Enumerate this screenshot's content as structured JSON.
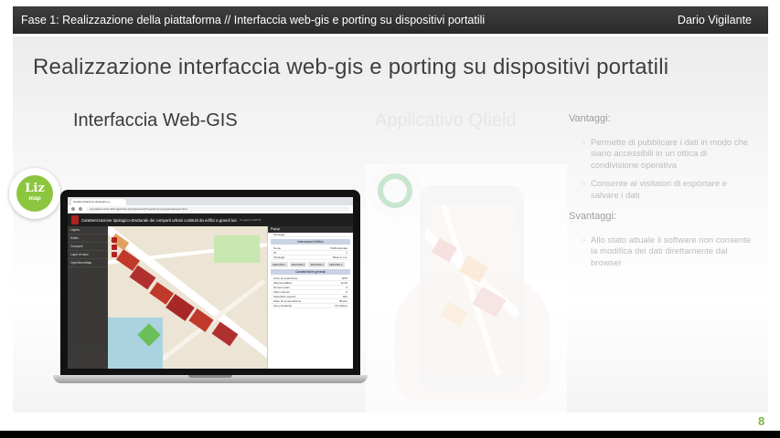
{
  "header": {
    "breadcrumb": "Fase 1: Realizzazione della piattaforma // Interfaccia web-gis e porting su dispositivi portatili",
    "author": "Dario Vigilante"
  },
  "slide": {
    "title": "Realizzazione interfaccia web-gis e porting su dispositivi portatili",
    "left_heading": "Interfaccia Web-GIS",
    "right_heading": "Applicativo Qfield",
    "page_number": "8"
  },
  "bullets": {
    "vantaggi_heading": "Vantaggi:",
    "vantaggi": [
      "Permette di pubblicare i dati in modo che siano accessibili in un ottica di condivisione operativa",
      "Consente ai visitatori di esportare e salvare i dati"
    ],
    "svantaggi_heading": "Svantaggi:",
    "svantaggi": [
      "Allo stato attuale il software non consente la modifica dei dati direttamente dal browser"
    ]
  },
  "logos": {
    "liz_text": "Liz",
    "liz_sub": "map"
  },
  "laptop_screen": {
    "tab_title": "Caratterizzazione tipologico-s...",
    "address": "sigmaterra.unict.it/lizmap/index.php/view/map/?repository=progetto&project=test",
    "app_title": "Caratterizzazione tipologico-strutturale dei comparti urbani costituiti da edifici a grandi luci",
    "app_sub": "Progetto CARTIS",
    "side_rows": [
      "Layers",
      "Edifici",
      "Comparti",
      "Layer di base",
      "OpenStreetMap"
    ],
    "panel_bar": "Popup",
    "panel_sub": "Tipologia",
    "panel_header": "Informazioni Edificio",
    "panel_lines": [
      [
        "Nome",
        "Polifunzionale"
      ],
      [
        "ID",
        "1"
      ],
      [
        "Tipologia",
        "Telaio in c.a."
      ]
    ],
    "tabs": [
      "SEZIONE 1",
      "SEZIONE 2",
      "SEZIONE 3",
      "SEZIONE 4"
    ],
    "section_header": "Caratteristiche generali",
    "section_lines": [
      [
        "Anno di costruzione",
        "1975"
      ],
      [
        "Altezza edificio",
        "12.40"
      ],
      [
        "Numero piani",
        "3"
      ],
      [
        "Piani interrati",
        "0"
      ],
      [
        "Superficie coperta",
        "842"
      ],
      [
        "Stato di conservazione",
        "Buono"
      ],
      [
        "Uso prevalente",
        "Produttivo"
      ]
    ]
  }
}
